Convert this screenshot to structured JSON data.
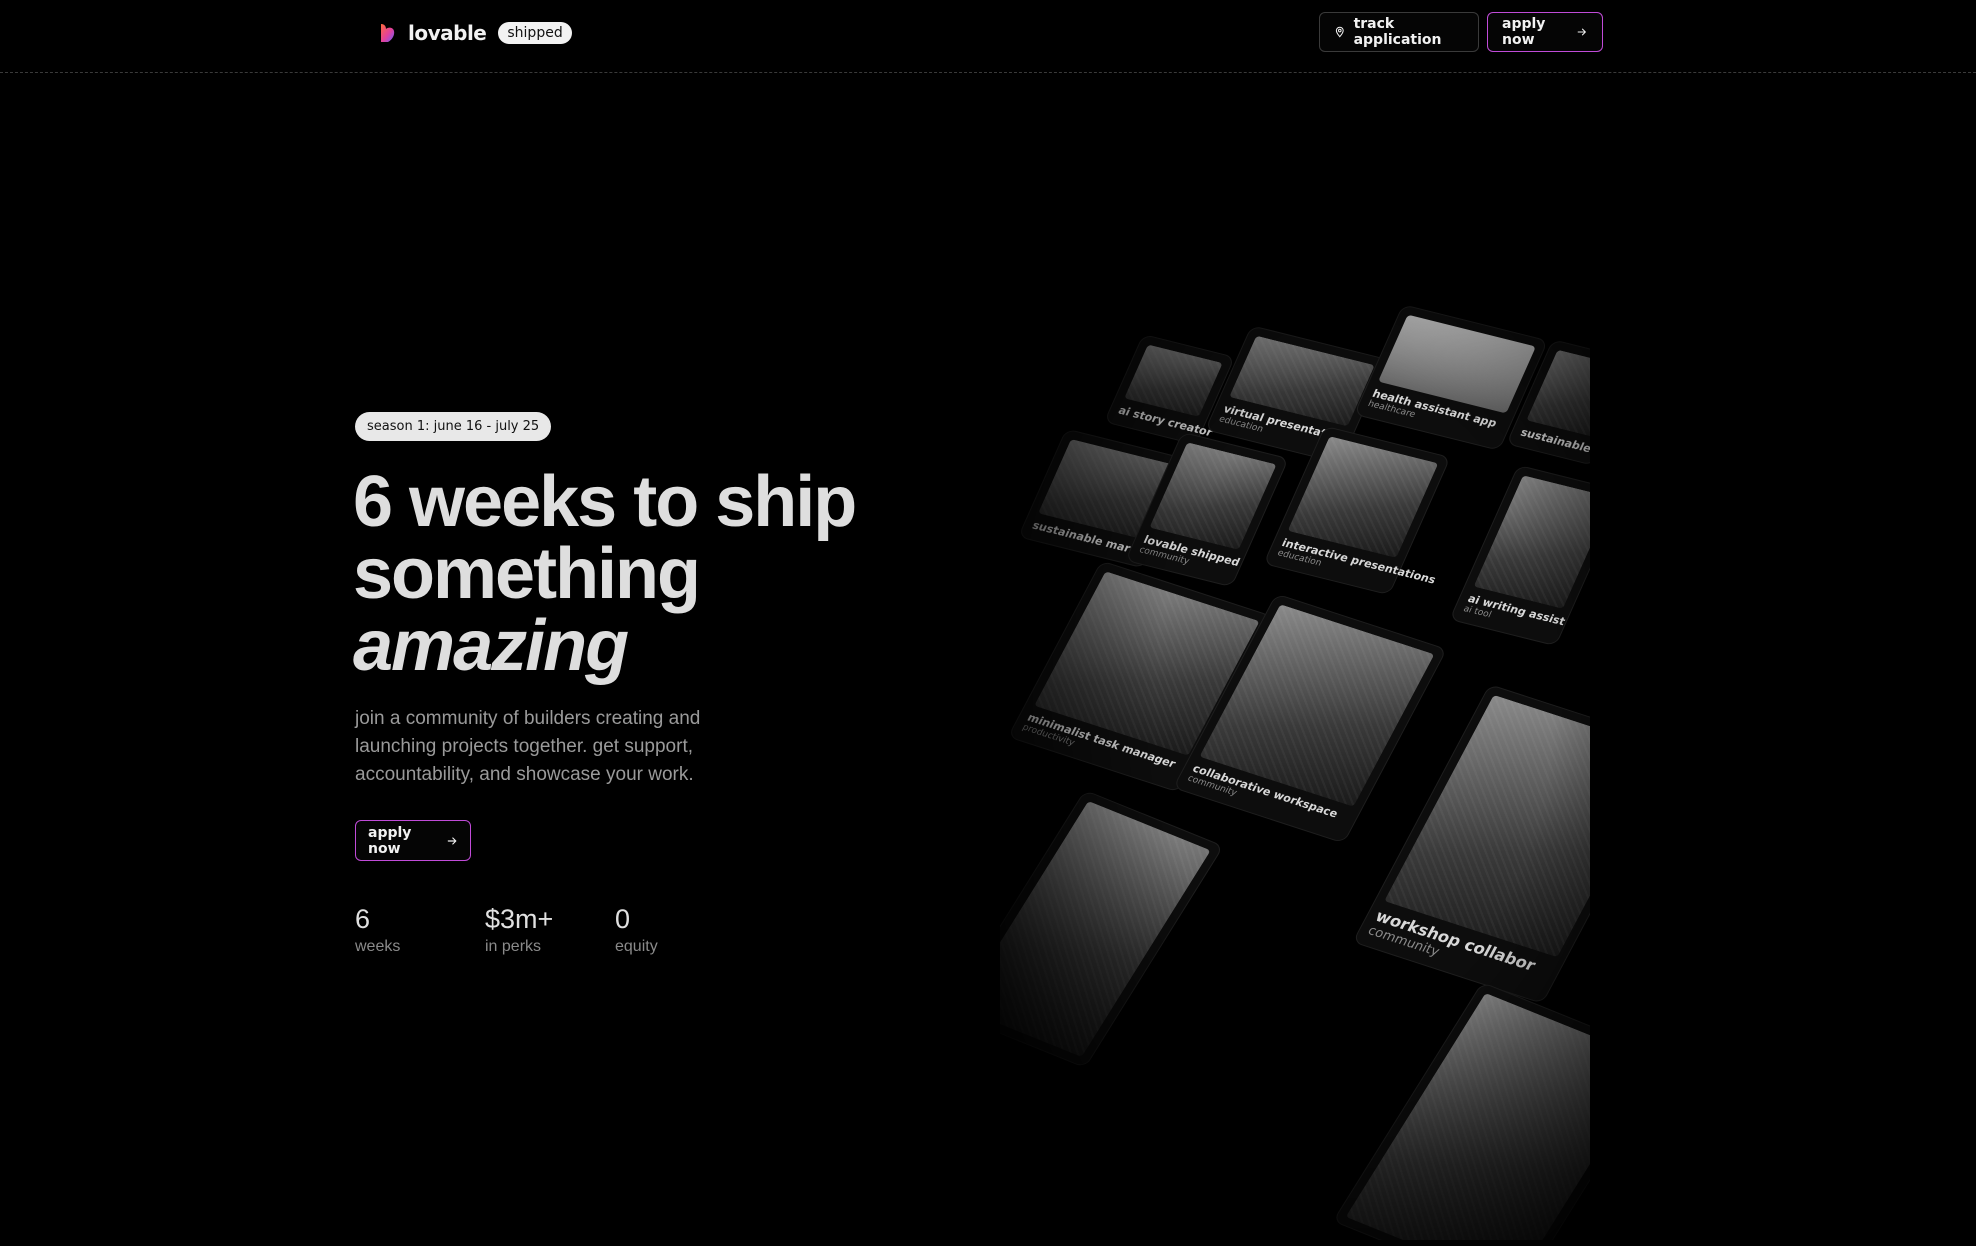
{
  "header": {
    "logo_text": "lovable",
    "logo_badge": "shipped",
    "track_label": "track application",
    "apply_label": "apply now"
  },
  "hero": {
    "season_badge": "season 1: june 16 - july 25",
    "headline_line1": "6 weeks to ship",
    "headline_line2": "something",
    "headline_line3": "amazing",
    "subtext": "join a community of builders creating and launching projects together. get support, accountability, and showcase your work.",
    "apply_label": "apply now"
  },
  "stats": [
    {
      "value": "6",
      "label": "weeks"
    },
    {
      "value": "$3m+",
      "label": "in perks"
    },
    {
      "value": "0",
      "label": "equity"
    }
  ],
  "gallery": {
    "cards": [
      {
        "title": "ai story creator",
        "category": ""
      },
      {
        "title": "virtual presentations",
        "category": "education"
      },
      {
        "title": "health assistant app",
        "category": "healthcare"
      },
      {
        "title": "sustainable",
        "category": ""
      },
      {
        "title": "sustainable marketplace",
        "category": ""
      },
      {
        "title": "lovable shipped",
        "category": "community"
      },
      {
        "title": "interactive presentations",
        "category": "education"
      },
      {
        "title": "ai writing assist",
        "category": "ai tool"
      },
      {
        "title": "minimalist task manager",
        "category": "productivity"
      },
      {
        "title": "collaborative workspace",
        "category": "community"
      },
      {
        "title": "workshop collabor",
        "category": "community"
      }
    ]
  }
}
